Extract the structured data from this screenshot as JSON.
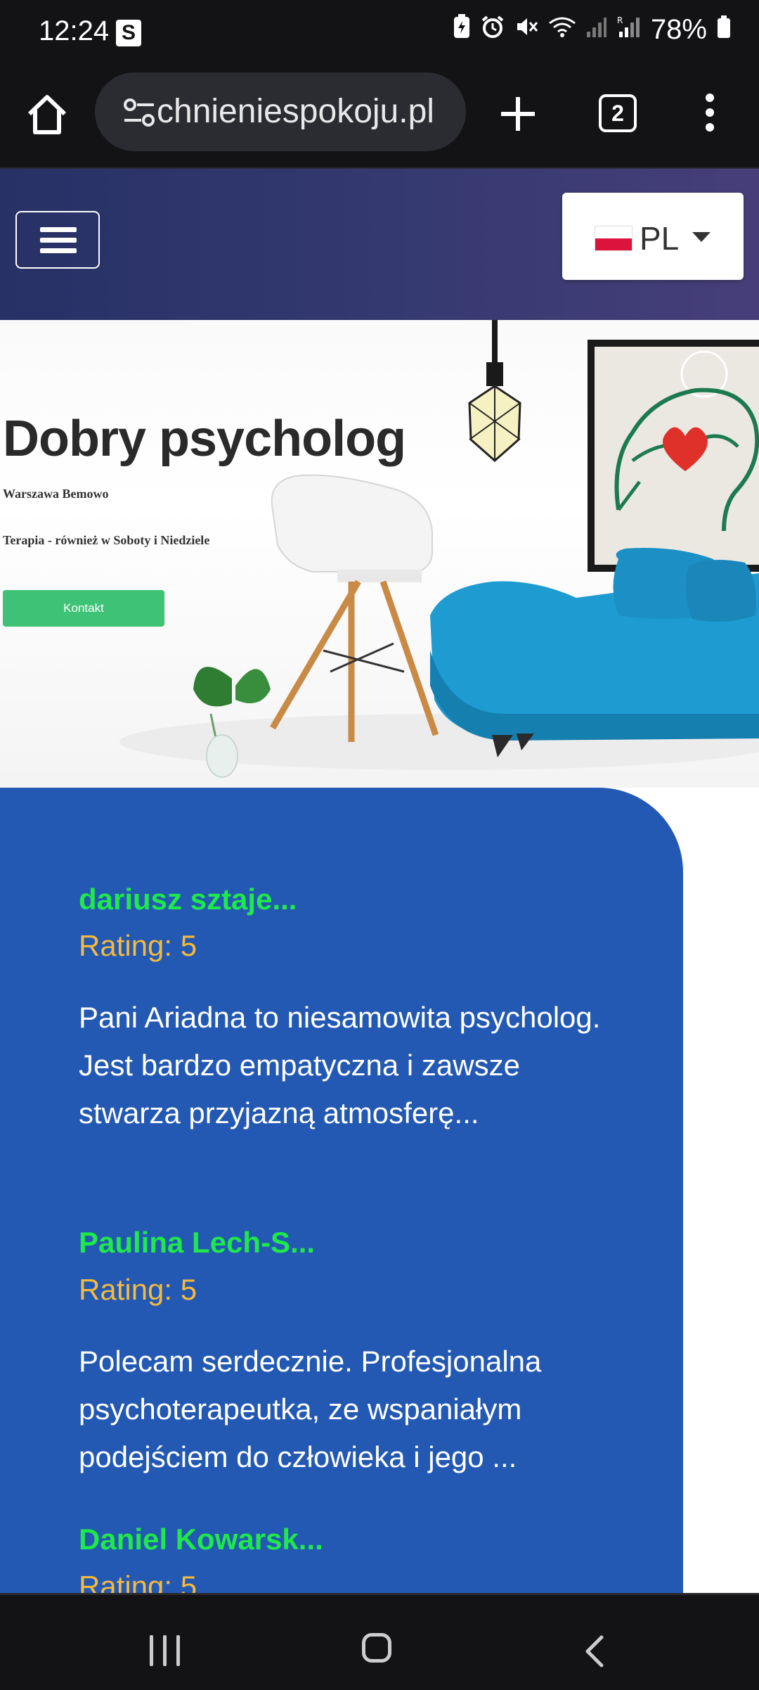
{
  "status_bar": {
    "time": "12:24",
    "notif_badge": "S",
    "battery": "78%"
  },
  "browser": {
    "url": "chnieniespokoju.pl",
    "tab_count": "2"
  },
  "header": {
    "language": "PL"
  },
  "hero": {
    "title": "Dobry psycholog",
    "location": "Warszawa Bemowo",
    "therapy_note": "Terapia - również w Soboty i Niedziele",
    "contact_label": "Kontakt"
  },
  "reviews": [
    {
      "name": "dariusz sztaje...",
      "rating": "Rating: 5",
      "text": "Pani Ariadna to niesamowita psycholog. Jest bardzo empatyczna i zawsze stwarza przyjazną atmosferę..."
    },
    {
      "name": "Paulina Lech-S...",
      "rating": "Rating: 5",
      "text": "Polecam serdecznie. Profesjonalna psychoterapeutka, ze wspaniałym podejściem do człowieka i jego ..."
    },
    {
      "name": "Daniel Kowarsk...",
      "rating": "Rating: 5",
      "text": ""
    }
  ],
  "colors": {
    "header_gradient_start": "#273166",
    "header_gradient_end": "#473e79",
    "contact_button": "#3ec276",
    "reviews_bg": "#2359b3",
    "review_name": "#1fe84a",
    "review_rating": "#f4b93f",
    "sofa": "#1e9bd1"
  },
  "icons": {
    "home": "home-icon",
    "site_info": "tune-icon",
    "new_tab": "plus-icon",
    "tabs": "tab-switcher-icon",
    "menu": "more-vert-icon",
    "hamburger": "hamburger-icon",
    "flag": "poland-flag-icon",
    "nav_recents": "recents-icon",
    "nav_home": "home-outline-icon",
    "nav_back": "back-icon"
  }
}
